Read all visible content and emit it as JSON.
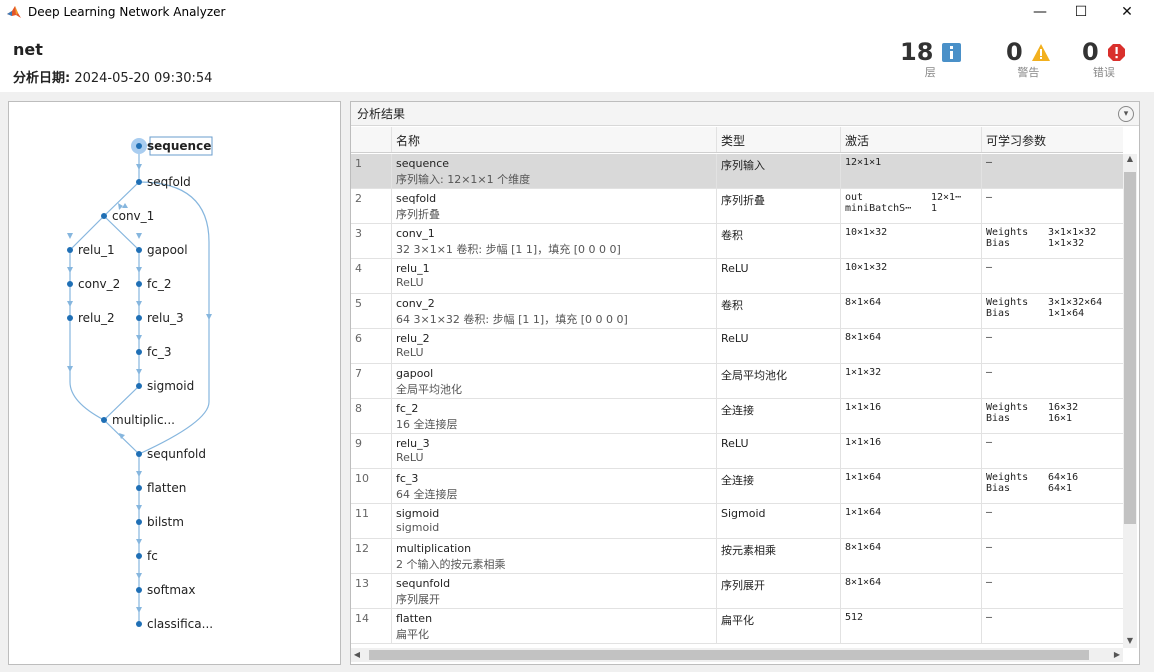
{
  "window": {
    "title": "Deep Learning Network Analyzer",
    "minimize": "—",
    "maximize": "☐",
    "close": "✕"
  },
  "header": {
    "net_name": "net",
    "date_label": "分析日期:",
    "date_value": "2024-05-20 09:30:54",
    "layers_count": "18",
    "layers_label": "层",
    "warnings_count": "0",
    "warnings_label": "警告",
    "errors_count": "0",
    "errors_label": "错误"
  },
  "graph": {
    "nodes": [
      {
        "name": "sequence"
      },
      {
        "name": "seqfold"
      },
      {
        "name": "conv_1"
      },
      {
        "name": "relu_1"
      },
      {
        "name": "gapool"
      },
      {
        "name": "conv_2"
      },
      {
        "name": "fc_2"
      },
      {
        "name": "relu_2"
      },
      {
        "name": "relu_3"
      },
      {
        "name": "fc_3"
      },
      {
        "name": "sigmoid"
      },
      {
        "name": "multiplic..."
      },
      {
        "name": "sequnfold"
      },
      {
        "name": "flatten"
      },
      {
        "name": "bilstm"
      },
      {
        "name": "fc"
      },
      {
        "name": "softmax"
      },
      {
        "name": "classifica..."
      }
    ]
  },
  "results": {
    "title": "分析结果",
    "headers": [
      "",
      "名称",
      "类型",
      "激活",
      "可学习参数"
    ],
    "rows": [
      {
        "idx": "1",
        "name": "sequence",
        "desc": "序列输入: 12×1×1 个维度",
        "type": "序列输入",
        "act": "12×1×1",
        "params": "–"
      },
      {
        "idx": "2",
        "name": "seqfold",
        "desc": "序列折叠",
        "type": "序列折叠",
        "act_k1": "out",
        "act_v1": "12×1⋯",
        "act_k2": "miniBatchS⋯",
        "act_v2": "1",
        "params": "–"
      },
      {
        "idx": "3",
        "name": "conv_1",
        "desc": "32 3×1×1 卷积: 步幅 [1 1]，填充 [0 0 0 0]",
        "type": "卷积",
        "act": "10×1×32",
        "p_k1": "Weights",
        "p_v1": "3×1×1×32",
        "p_k2": "Bias",
        "p_v2": "1×1×32"
      },
      {
        "idx": "4",
        "name": "relu_1",
        "desc": "ReLU",
        "type": "ReLU",
        "act": "10×1×32",
        "params": "–"
      },
      {
        "idx": "5",
        "name": "conv_2",
        "desc": "64 3×1×32 卷积: 步幅 [1 1]，填充 [0 0 0 0]",
        "type": "卷积",
        "act": "8×1×64",
        "p_k1": "Weights",
        "p_v1": "3×1×32×64",
        "p_k2": "Bias",
        "p_v2": "1×1×64"
      },
      {
        "idx": "6",
        "name": "relu_2",
        "desc": "ReLU",
        "type": "ReLU",
        "act": "8×1×64",
        "params": "–"
      },
      {
        "idx": "7",
        "name": "gapool",
        "desc": "全局平均池化",
        "type": "全局平均池化",
        "act": "1×1×32",
        "params": "–"
      },
      {
        "idx": "8",
        "name": "fc_2",
        "desc": "16 全连接层",
        "type": "全连接",
        "act": "1×1×16",
        "p_k1": "Weights",
        "p_v1": "16×32",
        "p_k2": "Bias",
        "p_v2": "16×1"
      },
      {
        "idx": "9",
        "name": "relu_3",
        "desc": "ReLU",
        "type": "ReLU",
        "act": "1×1×16",
        "params": "–"
      },
      {
        "idx": "10",
        "name": "fc_3",
        "desc": "64 全连接层",
        "type": "全连接",
        "act": "1×1×64",
        "p_k1": "Weights",
        "p_v1": "64×16",
        "p_k2": "Bias",
        "p_v2": "64×1"
      },
      {
        "idx": "11",
        "name": "sigmoid",
        "desc": "sigmoid",
        "type": "Sigmoid",
        "act": "1×1×64",
        "params": "–"
      },
      {
        "idx": "12",
        "name": "multiplication",
        "desc": "2 个输入的按元素相乘",
        "type": "按元素相乘",
        "act": "8×1×64",
        "params": "–"
      },
      {
        "idx": "13",
        "name": "sequnfold",
        "desc": "序列展开",
        "type": "序列展开",
        "act": "8×1×64",
        "params": "–"
      },
      {
        "idx": "14",
        "name": "flatten",
        "desc": "扁平化",
        "type": "扁平化",
        "act": "512",
        "params": "–"
      }
    ]
  },
  "colors": {
    "node": "#1f6fb5",
    "edge": "#86b6de",
    "selected_row": "#d9d9d9",
    "info_badge": "#4a90c8",
    "warning_badge": "#f2b01e",
    "error_badge": "#d9302c"
  }
}
